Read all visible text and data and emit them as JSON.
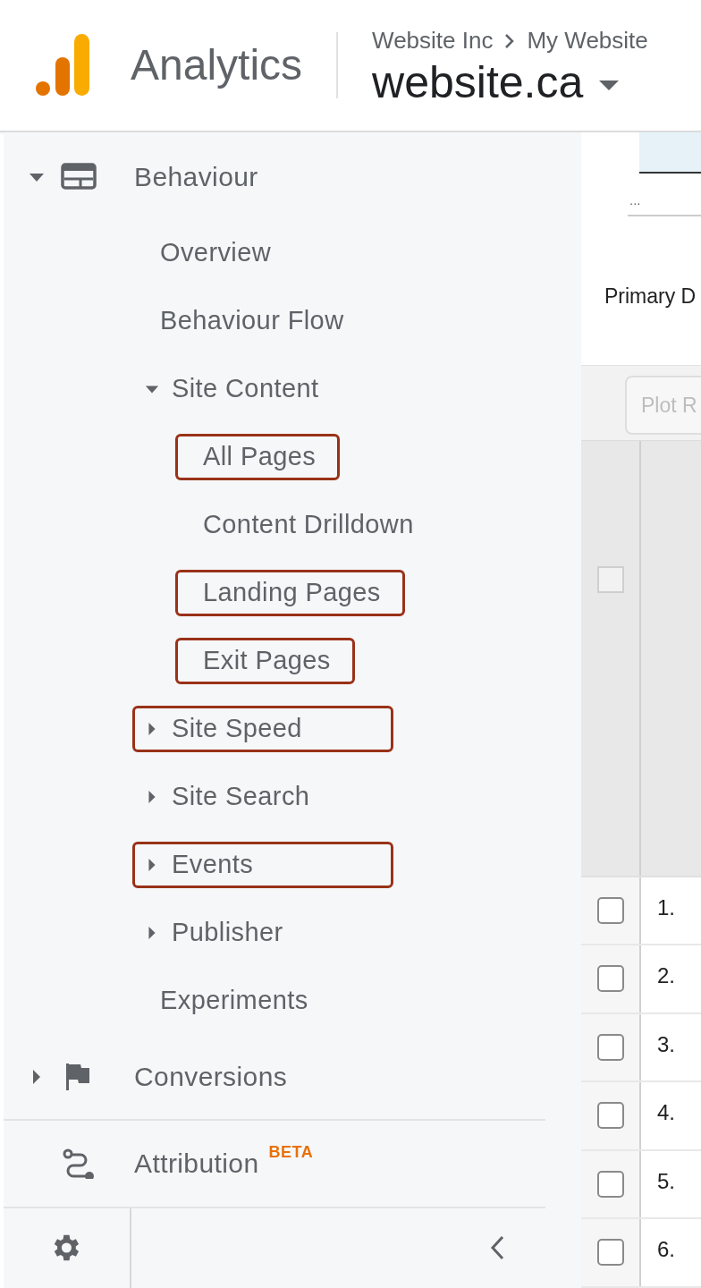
{
  "header": {
    "product": "Analytics",
    "breadcrumb": [
      "Website Inc",
      "My Website"
    ],
    "property": "website.ca"
  },
  "nav_sections": [
    {
      "items": [
        {
          "label": "Behaviour",
          "expanded": true,
          "highlighted": false,
          "children": [
            {
              "label": "Overview",
              "highlighted": false
            },
            {
              "label": "Behaviour Flow",
              "highlighted": false
            },
            {
              "label": "Site Content",
              "expanded": true,
              "highlighted": false,
              "children": [
                {
                  "label": "All Pages",
                  "highlighted": true
                },
                {
                  "label": "Content Drilldown",
                  "highlighted": false
                },
                {
                  "label": "Landing Pages",
                  "highlighted": true
                },
                {
                  "label": "Exit Pages",
                  "highlighted": true
                }
              ]
            },
            {
              "label": "Site Speed",
              "expanded": false,
              "highlighted": true
            },
            {
              "label": "Site Search",
              "expanded": false,
              "highlighted": false
            },
            {
              "label": "Events",
              "expanded": false,
              "highlighted": true
            },
            {
              "label": "Publisher",
              "expanded": false,
              "highlighted": false
            },
            {
              "label": "Experiments",
              "highlighted": false
            }
          ]
        },
        {
          "label": "Conversions",
          "expanded": false,
          "highlighted": false
        }
      ]
    },
    {
      "items": [
        {
          "label": "Attribution",
          "badge": "BETA",
          "highlighted": false
        }
      ]
    }
  ],
  "content": {
    "metric_selector": {
      "value": "..."
    },
    "primary_dimension": "Primary D",
    "toolbar": {
      "button": "Plot R",
      "disabled": true
    },
    "table": {
      "header_checkbox": {
        "checked": false,
        "disabled": true
      },
      "rows": [
        {
          "number": "1.",
          "checked": false
        },
        {
          "number": "2.",
          "checked": false
        },
        {
          "number": "3.",
          "checked": false
        },
        {
          "number": "4.",
          "checked": false
        },
        {
          "number": "5.",
          "checked": false
        },
        {
          "number": "6.",
          "checked": false
        }
      ]
    }
  }
}
